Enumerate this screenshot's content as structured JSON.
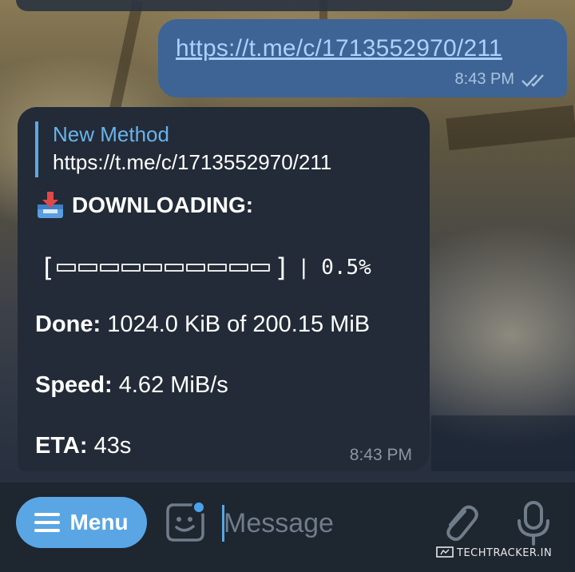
{
  "outgoing": {
    "link": "https://t.me/c/1713552970/211",
    "time": "8:43 PM",
    "status": "double-check-icon"
  },
  "incoming": {
    "reply_title": "New Method",
    "reply_text": "https://t.me/c/1713552970/211",
    "heading_icon": "inbox-tray-icon",
    "heading": "DOWNLOADING:",
    "progress": {
      "open": "[",
      "close": "]",
      "separator": "|",
      "percent_label": "0.5%",
      "fraction": 0.005,
      "cells": 10
    },
    "done_label": "Done:",
    "done_value": "1024.0 KiB of 200.15 MiB",
    "speed_label": "Speed:",
    "speed_value": "4.62 MiB/s",
    "eta_label": "ETA:",
    "eta_value": "43s",
    "time": "8:43 PM"
  },
  "input_bar": {
    "menu_label": "Menu",
    "placeholder": "Message",
    "sticker_icon": "sticker-icon",
    "attach_icon": "paperclip-icon",
    "mic_icon": "microphone-icon"
  },
  "watermark": {
    "text": "TECHTRACKER.IN"
  },
  "colors": {
    "accent": "#5aa6e4",
    "outgoing_bubble": "#3d6494",
    "incoming_bubble": "#222b37",
    "link": "#a9d2ff"
  }
}
